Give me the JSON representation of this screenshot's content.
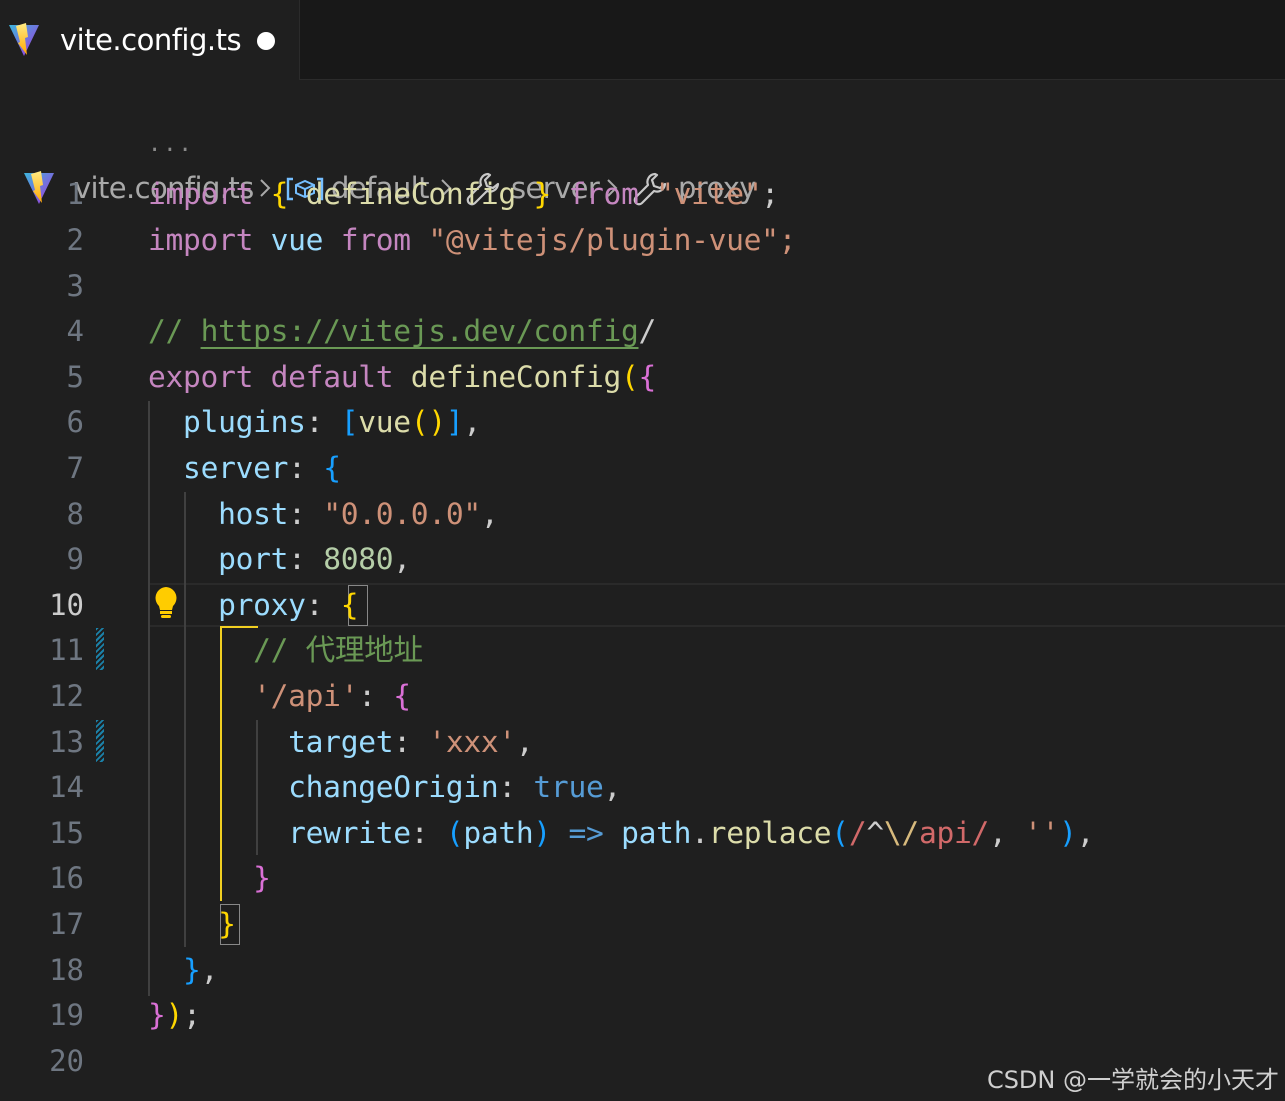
{
  "tab": {
    "title": "vite.config.ts",
    "modified": true,
    "icon": "vite-icon"
  },
  "breadcrumb": {
    "file": "vite.config.ts",
    "items": [
      {
        "icon": "variable-icon",
        "label": "default"
      },
      {
        "icon": "wrench-icon",
        "label": "server"
      },
      {
        "icon": "wrench-icon",
        "label": "proxy"
      }
    ],
    "separator": ">"
  },
  "editor": {
    "collapsed_marker": "...",
    "current_line": 10,
    "line_numbers": [
      "1",
      "2",
      "3",
      "4",
      "5",
      "6",
      "7",
      "8",
      "9",
      "10",
      "11",
      "12",
      "13",
      "14",
      "15",
      "16",
      "17",
      "18",
      "19",
      "20"
    ],
    "lines": [
      "import { defineConfig } from \"vite\";",
      "import vue from \"@vitejs/plugin-vue\";",
      "",
      "// https://vitejs.dev/config/",
      "export default defineConfig({",
      "  plugins: [vue()],",
      "  server: {",
      "    host: \"0.0.0.0\",",
      "    port: 8080,",
      "    proxy: {",
      "      // 代理地址",
      "      '/api': {",
      "        target: 'xxx',",
      "        changeOrigin: true,",
      "        rewrite: (path) => path.replace(/^\\/api/, ''),",
      "      }",
      "    }",
      "  },",
      "});",
      ""
    ]
  },
  "watermark": "CSDN @一学就会的小天才",
  "colors": {
    "background": "#1f1f1f",
    "keyword": "#c586c0",
    "function": "#dcdcaa",
    "variable": "#9cdcfe",
    "string": "#ce9178",
    "number": "#b5cea8",
    "comment": "#6a9955",
    "bracket_gold": "#ffd700",
    "bracket_orchid": "#da70d6",
    "bracket_blue": "#179fff",
    "active_guide": "#f1cf21"
  }
}
